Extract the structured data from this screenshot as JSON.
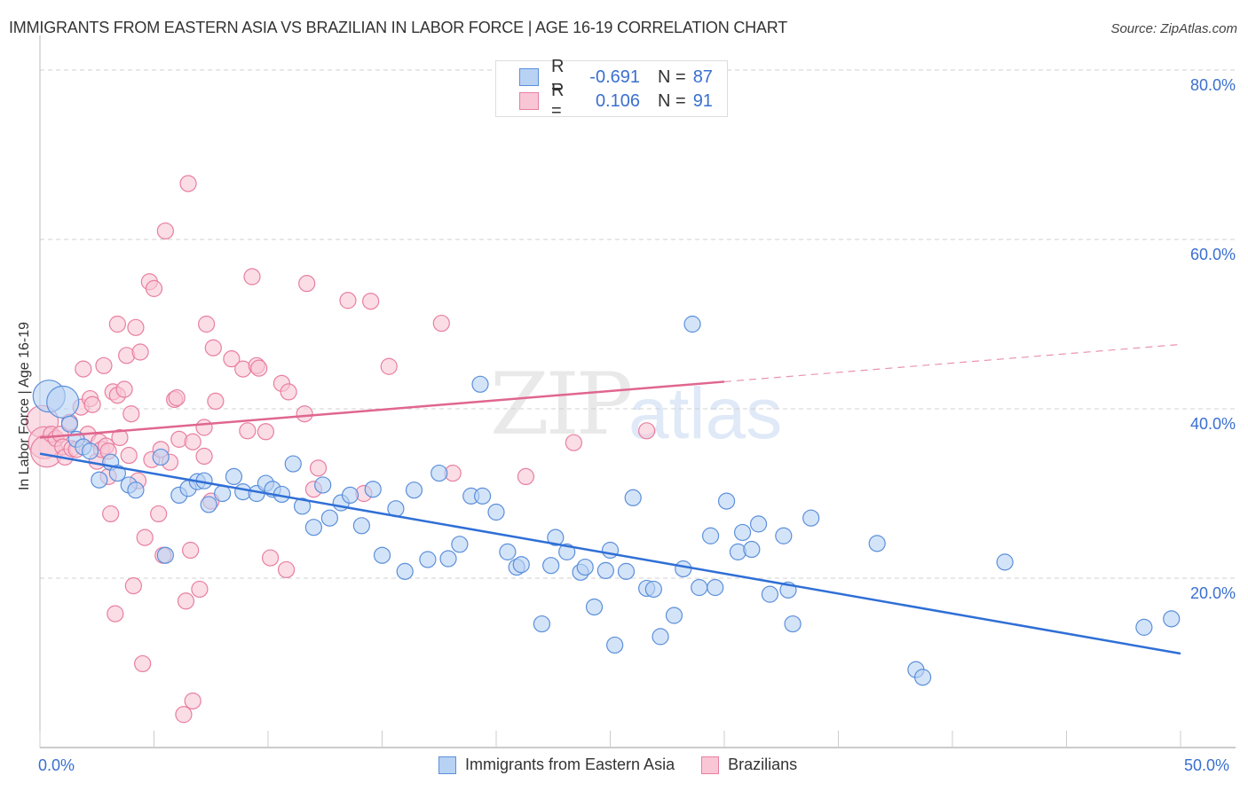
{
  "title": "IMMIGRANTS FROM EASTERN ASIA VS BRAZILIAN IN LABOR FORCE | AGE 16-19 CORRELATION CHART",
  "source": "Source: ZipAtlas.com",
  "watermark": {
    "zip": "ZIP",
    "atlas": "atlas"
  },
  "legend_top": [
    {
      "r_label": "R =",
      "r_value": "-0.691",
      "n_label": "N =",
      "n_value": "87"
    },
    {
      "r_label": "R =",
      "r_value": "0.106",
      "n_label": "N =",
      "n_value": "91"
    }
  ],
  "colors": {
    "blue_fill": "#b8d2f3",
    "blue_stroke": "#5b8fdb",
    "blue_line": "#2f6fd6",
    "pink_fill": "#f9c6d6",
    "pink_stroke": "#e87fa0",
    "pink_line": "#e0668f",
    "axis_text": "#3a6fd0",
    "grid": "#d0d0d0"
  },
  "chart_data": {
    "type": "scatter",
    "title": "IMMIGRANTS FROM EASTERN ASIA VS BRAZILIAN IN LABOR FORCE | AGE 16-19 CORRELATION CHART",
    "xlabel": "",
    "ylabel": "In Labor Force | Age 16-19",
    "xlim": [
      0,
      50
    ],
    "ylim": [
      0,
      80
    ],
    "x_tick_labels": [
      "0.0%",
      "50.0%"
    ],
    "x_minor_ticks": [
      0,
      5,
      10,
      15,
      20,
      25,
      30,
      35,
      40,
      45,
      50
    ],
    "y_tick_labels": [
      "20.0%",
      "40.0%",
      "60.0%",
      "80.0%"
    ],
    "y_ticks": [
      20,
      40,
      60,
      80
    ],
    "grid": true,
    "legend_placement": "bottom-center",
    "series": [
      {
        "name": "Immigrants from Eastern Asia",
        "R": -0.691,
        "N": 87,
        "trend": {
          "x": [
            0,
            50
          ],
          "y": [
            34.7,
            11.1
          ],
          "dashed_from": null
        },
        "points": [
          {
            "x": 0.4,
            "y": 41.5,
            "big": true
          },
          {
            "x": 1.0,
            "y": 40.8,
            "big": true
          },
          {
            "x": 1.3,
            "y": 38.2
          },
          {
            "x": 1.6,
            "y": 36.4
          },
          {
            "x": 1.9,
            "y": 35.5
          },
          {
            "x": 2.2,
            "y": 35.0
          },
          {
            "x": 2.6,
            "y": 31.6
          },
          {
            "x": 3.1,
            "y": 33.7
          },
          {
            "x": 3.4,
            "y": 32.4
          },
          {
            "x": 3.9,
            "y": 31.0
          },
          {
            "x": 4.2,
            "y": 30.4
          },
          {
            "x": 5.3,
            "y": 34.3
          },
          {
            "x": 5.5,
            "y": 22.7
          },
          {
            "x": 6.1,
            "y": 29.8
          },
          {
            "x": 6.5,
            "y": 30.6
          },
          {
            "x": 6.9,
            "y": 31.4
          },
          {
            "x": 7.2,
            "y": 31.5
          },
          {
            "x": 7.4,
            "y": 28.7
          },
          {
            "x": 8.0,
            "y": 30.0
          },
          {
            "x": 8.5,
            "y": 32.0
          },
          {
            "x": 8.9,
            "y": 30.2
          },
          {
            "x": 9.5,
            "y": 30.0
          },
          {
            "x": 9.9,
            "y": 31.2
          },
          {
            "x": 10.2,
            "y": 30.5
          },
          {
            "x": 10.6,
            "y": 29.9
          },
          {
            "x": 11.1,
            "y": 33.5
          },
          {
            "x": 11.5,
            "y": 28.5
          },
          {
            "x": 12.0,
            "y": 26.0
          },
          {
            "x": 12.4,
            "y": 31.0
          },
          {
            "x": 12.7,
            "y": 27.1
          },
          {
            "x": 13.2,
            "y": 28.9
          },
          {
            "x": 13.6,
            "y": 29.8
          },
          {
            "x": 14.1,
            "y": 26.2
          },
          {
            "x": 14.6,
            "y": 30.5
          },
          {
            "x": 15.0,
            "y": 22.7
          },
          {
            "x": 15.6,
            "y": 28.2
          },
          {
            "x": 16.0,
            "y": 20.8
          },
          {
            "x": 16.4,
            "y": 30.4
          },
          {
            "x": 17.0,
            "y": 22.2
          },
          {
            "x": 17.5,
            "y": 32.4
          },
          {
            "x": 17.9,
            "y": 22.3
          },
          {
            "x": 18.4,
            "y": 24.0
          },
          {
            "x": 18.9,
            "y": 29.7
          },
          {
            "x": 19.4,
            "y": 29.7
          },
          {
            "x": 19.3,
            "y": 42.9
          },
          {
            "x": 20.0,
            "y": 27.8
          },
          {
            "x": 20.5,
            "y": 23.1
          },
          {
            "x": 20.9,
            "y": 21.3
          },
          {
            "x": 21.1,
            "y": 21.6
          },
          {
            "x": 22.0,
            "y": 14.6
          },
          {
            "x": 22.4,
            "y": 21.5
          },
          {
            "x": 22.6,
            "y": 24.8
          },
          {
            "x": 23.1,
            "y": 23.1
          },
          {
            "x": 23.7,
            "y": 20.7
          },
          {
            "x": 23.9,
            "y": 21.3
          },
          {
            "x": 24.3,
            "y": 16.6
          },
          {
            "x": 24.8,
            "y": 20.9
          },
          {
            "x": 25.0,
            "y": 23.3
          },
          {
            "x": 25.2,
            "y": 12.1
          },
          {
            "x": 25.7,
            "y": 20.8
          },
          {
            "x": 26.0,
            "y": 29.5
          },
          {
            "x": 26.6,
            "y": 18.8
          },
          {
            "x": 26.9,
            "y": 18.7
          },
          {
            "x": 27.2,
            "y": 13.1
          },
          {
            "x": 27.8,
            "y": 15.6
          },
          {
            "x": 28.2,
            "y": 21.1
          },
          {
            "x": 28.6,
            "y": 50.0
          },
          {
            "x": 28.9,
            "y": 18.9
          },
          {
            "x": 29.4,
            "y": 25.0
          },
          {
            "x": 29.6,
            "y": 18.9
          },
          {
            "x": 30.1,
            "y": 29.1
          },
          {
            "x": 30.6,
            "y": 23.1
          },
          {
            "x": 30.8,
            "y": 25.4
          },
          {
            "x": 31.2,
            "y": 23.4
          },
          {
            "x": 31.5,
            "y": 26.4
          },
          {
            "x": 32.0,
            "y": 18.1
          },
          {
            "x": 32.6,
            "y": 25.0
          },
          {
            "x": 32.8,
            "y": 18.6
          },
          {
            "x": 33.0,
            "y": 14.6
          },
          {
            "x": 33.8,
            "y": 27.1
          },
          {
            "x": 36.7,
            "y": 24.1
          },
          {
            "x": 38.4,
            "y": 9.2
          },
          {
            "x": 38.7,
            "y": 8.3
          },
          {
            "x": 42.3,
            "y": 21.9
          },
          {
            "x": 48.4,
            "y": 14.2
          },
          {
            "x": 49.6,
            "y": 15.2
          }
        ]
      },
      {
        "name": "Brazilians",
        "R": 0.106,
        "N": 91,
        "trend": {
          "x": [
            0,
            50
          ],
          "y": [
            36.6,
            47.6
          ],
          "dashed_from": 30.0
        },
        "points": [
          {
            "x": 0.1,
            "y": 38.5,
            "big": true
          },
          {
            "x": 0.2,
            "y": 36.0,
            "big": true
          },
          {
            "x": 0.3,
            "y": 35.0,
            "big": true
          },
          {
            "x": 0.5,
            "y": 37.0
          },
          {
            "x": 0.7,
            "y": 36.5
          },
          {
            "x": 0.9,
            "y": 37.0
          },
          {
            "x": 1.0,
            "y": 35.5
          },
          {
            "x": 1.1,
            "y": 34.3
          },
          {
            "x": 1.3,
            "y": 38.4
          },
          {
            "x": 1.4,
            "y": 35.3
          },
          {
            "x": 1.6,
            "y": 35.2
          },
          {
            "x": 1.8,
            "y": 40.2
          },
          {
            "x": 1.9,
            "y": 44.7
          },
          {
            "x": 2.1,
            "y": 37.0
          },
          {
            "x": 2.2,
            "y": 41.2
          },
          {
            "x": 2.3,
            "y": 40.5
          },
          {
            "x": 2.5,
            "y": 33.8
          },
          {
            "x": 2.6,
            "y": 36.1
          },
          {
            "x": 2.7,
            "y": 35.2
          },
          {
            "x": 2.8,
            "y": 45.1
          },
          {
            "x": 2.9,
            "y": 35.6
          },
          {
            "x": 3.0,
            "y": 35.0
          },
          {
            "x": 3.0,
            "y": 32.0
          },
          {
            "x": 3.1,
            "y": 27.6
          },
          {
            "x": 3.2,
            "y": 42.0
          },
          {
            "x": 3.3,
            "y": 15.8
          },
          {
            "x": 3.4,
            "y": 41.6
          },
          {
            "x": 3.4,
            "y": 50.0
          },
          {
            "x": 3.5,
            "y": 36.6
          },
          {
            "x": 3.7,
            "y": 42.3
          },
          {
            "x": 3.8,
            "y": 46.3
          },
          {
            "x": 3.9,
            "y": 34.5
          },
          {
            "x": 4.0,
            "y": 39.4
          },
          {
            "x": 4.1,
            "y": 19.1
          },
          {
            "x": 4.2,
            "y": 49.6
          },
          {
            "x": 4.3,
            "y": 31.5
          },
          {
            "x": 4.4,
            "y": 46.7
          },
          {
            "x": 4.5,
            "y": 9.9
          },
          {
            "x": 4.6,
            "y": 24.8
          },
          {
            "x": 4.8,
            "y": 55.0
          },
          {
            "x": 4.9,
            "y": 34.0
          },
          {
            "x": 5.0,
            "y": 54.2
          },
          {
            "x": 5.2,
            "y": 27.6
          },
          {
            "x": 5.3,
            "y": 35.2
          },
          {
            "x": 5.4,
            "y": 22.7
          },
          {
            "x": 5.5,
            "y": 61.0
          },
          {
            "x": 5.7,
            "y": 33.7
          },
          {
            "x": 5.9,
            "y": 41.1
          },
          {
            "x": 6.0,
            "y": 41.3
          },
          {
            "x": 6.1,
            "y": 36.4
          },
          {
            "x": 6.3,
            "y": 3.9
          },
          {
            "x": 6.4,
            "y": 17.3
          },
          {
            "x": 6.5,
            "y": 66.6
          },
          {
            "x": 6.6,
            "y": 23.3
          },
          {
            "x": 6.7,
            "y": 5.5
          },
          {
            "x": 6.7,
            "y": 36.1
          },
          {
            "x": 7.0,
            "y": 18.7
          },
          {
            "x": 7.2,
            "y": 37.8
          },
          {
            "x": 7.2,
            "y": 34.4
          },
          {
            "x": 7.3,
            "y": 50.0
          },
          {
            "x": 7.5,
            "y": 29.1
          },
          {
            "x": 7.6,
            "y": 47.2
          },
          {
            "x": 7.7,
            "y": 40.9
          },
          {
            "x": 8.4,
            "y": 45.9
          },
          {
            "x": 8.9,
            "y": 44.7
          },
          {
            "x": 9.1,
            "y": 37.4
          },
          {
            "x": 9.3,
            "y": 55.6
          },
          {
            "x": 9.5,
            "y": 45.1
          },
          {
            "x": 9.6,
            "y": 44.8
          },
          {
            "x": 9.9,
            "y": 37.3
          },
          {
            "x": 10.1,
            "y": 22.4
          },
          {
            "x": 10.6,
            "y": 43.0
          },
          {
            "x": 10.8,
            "y": 21.0
          },
          {
            "x": 10.9,
            "y": 42.0
          },
          {
            "x": 11.6,
            "y": 39.4
          },
          {
            "x": 11.7,
            "y": 54.8
          },
          {
            "x": 12.0,
            "y": 30.5
          },
          {
            "x": 12.2,
            "y": 33.0
          },
          {
            "x": 13.5,
            "y": 52.8
          },
          {
            "x": 14.2,
            "y": 30.0
          },
          {
            "x": 14.5,
            "y": 52.7
          },
          {
            "x": 15.3,
            "y": 45.0
          },
          {
            "x": 17.6,
            "y": 50.1
          },
          {
            "x": 18.1,
            "y": 32.4
          },
          {
            "x": 21.3,
            "y": 32.0
          },
          {
            "x": 23.4,
            "y": 36.0
          },
          {
            "x": 26.6,
            "y": 37.4
          }
        ]
      }
    ]
  },
  "bottom_legend": [
    {
      "label": "Immigrants from Eastern Asia"
    },
    {
      "label": "Brazilians"
    }
  ]
}
